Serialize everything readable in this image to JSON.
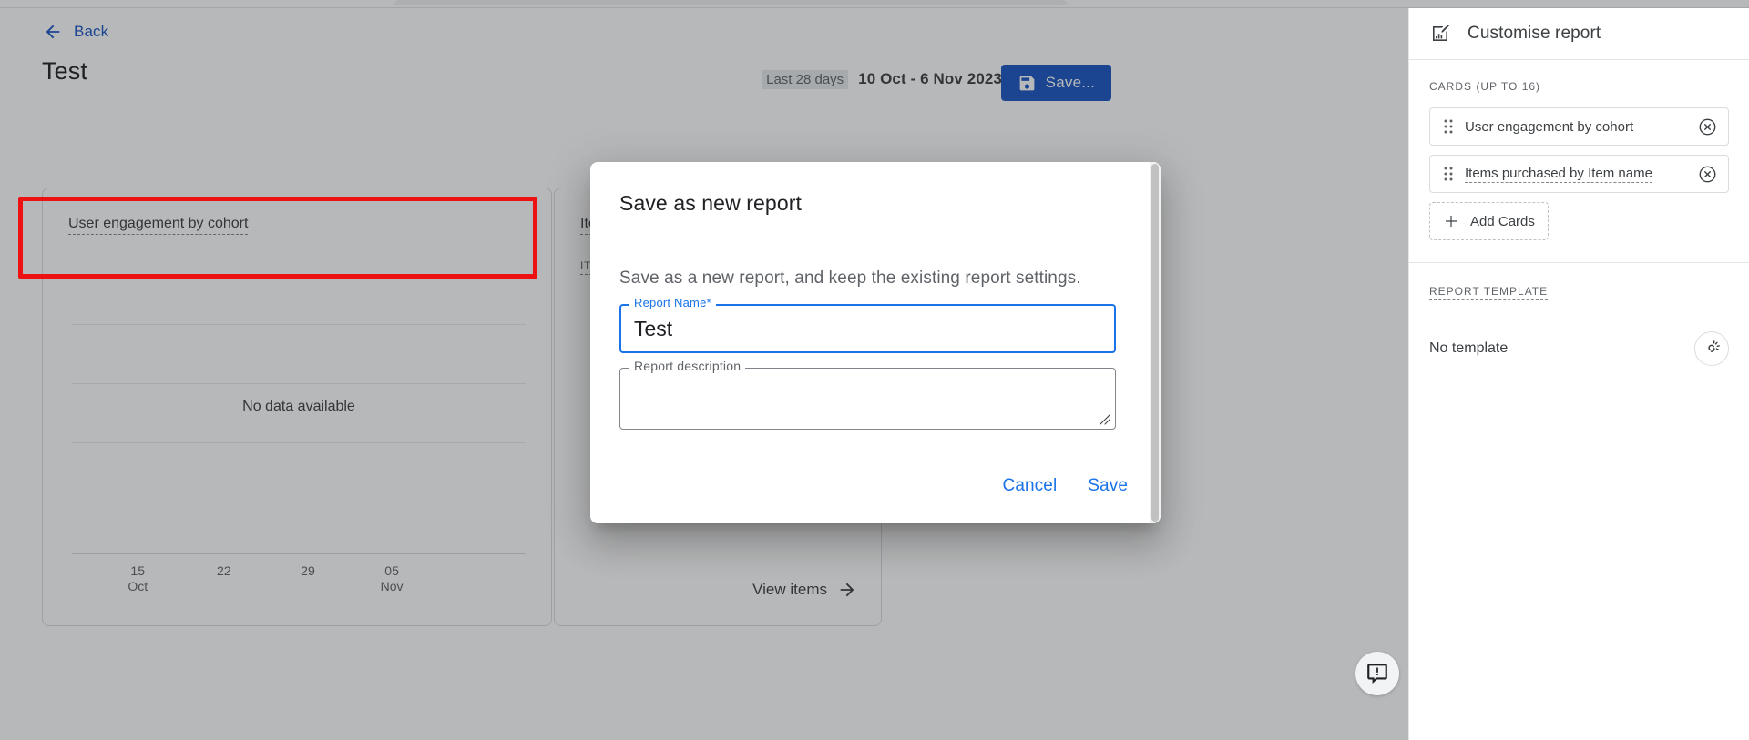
{
  "header": {
    "back_label": "Back",
    "page_title": "Test",
    "date_preset": "Last 28 days",
    "date_range": "10 Oct - 6 Nov 2023",
    "save_label": "Save...",
    "icons": {
      "back": "arrow-left-icon",
      "save": "floppy-disk-icon"
    }
  },
  "cards": {
    "engagement": {
      "title": "User engagement by cohort",
      "empty_message": "No data available"
    },
    "items": {
      "title": "Items purchased by Item name",
      "column_header": "ITEM NAME",
      "view_link": "View items"
    }
  },
  "chart_data": {
    "type": "line",
    "title": "User engagement by cohort",
    "empty_message": "No data available",
    "x": [
      "15",
      "22",
      "29",
      "05"
    ],
    "x_sublabels": [
      "Oct",
      "",
      "",
      "Nov"
    ],
    "series": [],
    "values": [],
    "xlabel": "",
    "ylabel": "",
    "grid": true,
    "gridline_count": 5,
    "legend": "none"
  },
  "sidebar": {
    "title": "Customise report",
    "title_icon": "chart-edit-icon",
    "cards_section_label": "CARDS (UP TO 16)",
    "cards": [
      {
        "label": "User engagement by cohort",
        "dotted": false,
        "drag_icon": "drag-handle-icon",
        "remove_icon": "remove-circle-icon"
      },
      {
        "label": "Items purchased by Item name",
        "dotted": true,
        "drag_icon": "drag-handle-icon",
        "remove_icon": "remove-circle-icon"
      }
    ],
    "add_cards_label": "Add Cards",
    "add_cards_icon": "plus-icon",
    "template_section_label": "REPORT TEMPLATE",
    "template_value": "No template",
    "template_icon": "template-unlink-icon"
  },
  "modal": {
    "title": "Save as new report",
    "description": "Save as a new report, and keep the existing report settings.",
    "name_field": {
      "label": "Report Name*",
      "value": "Test",
      "placeholder": ""
    },
    "description_field": {
      "label": "Report description",
      "value": "",
      "placeholder": ""
    },
    "cancel_label": "Cancel",
    "save_label": "Save"
  },
  "feedback": {
    "icon": "feedback-bubble-icon"
  },
  "colors": {
    "accent_blue": "#1a73e8",
    "button_blue": "#1a56c5",
    "annotation_red": "#ee1111",
    "text_primary": "#202124",
    "text_secondary": "#5f6368"
  }
}
